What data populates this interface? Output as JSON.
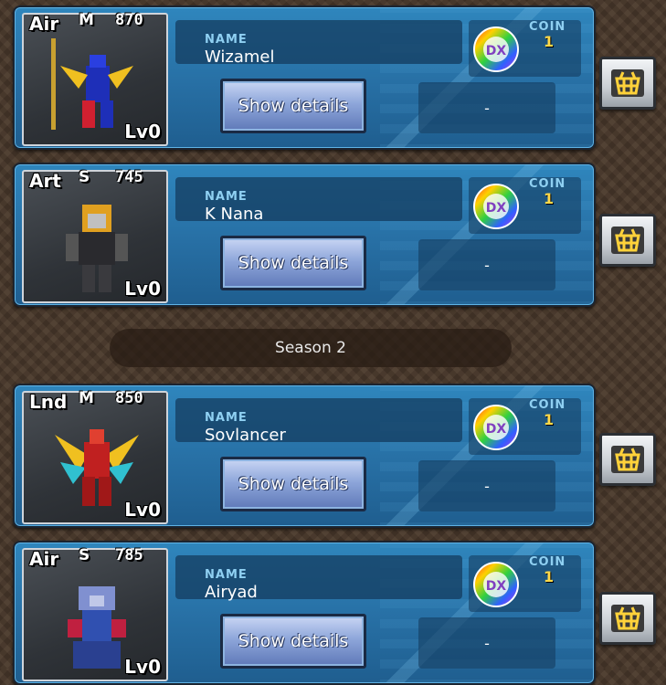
{
  "cards": [
    {
      "type": "Air",
      "size": "M",
      "cost": "870",
      "level": "Lv0",
      "name_label": "NAME",
      "name": "Wizamel",
      "button": "Show details",
      "coin_label": "COIN",
      "coin": "1",
      "status": "-",
      "colors": {
        "primary": "#1e2fb8",
        "accent": "#f0c020",
        "trim": "#d02030"
      }
    },
    {
      "type": "Art",
      "size": "S",
      "cost": "745",
      "level": "Lv0",
      "name_label": "NAME",
      "name": "K Nana",
      "button": "Show details",
      "coin_label": "COIN",
      "coin": "1",
      "status": "-",
      "colors": {
        "primary": "#2a2a2e",
        "accent": "#e0a020",
        "trim": "#909090"
      }
    },
    {
      "type": "Lnd",
      "size": "M",
      "cost": "850",
      "level": "Lv0",
      "name_label": "NAME",
      "name": "Sovlancer",
      "button": "Show details",
      "coin_label": "COIN",
      "coin": "1",
      "status": "-",
      "colors": {
        "primary": "#c02020",
        "accent": "#f0c020",
        "trim": "#30c0d0"
      }
    },
    {
      "type": "Air",
      "size": "S",
      "cost": "785",
      "level": "Lv0",
      "name_label": "NAME",
      "name": "Airyad",
      "button": "Show details",
      "coin_label": "COIN",
      "coin": "1",
      "status": "-",
      "colors": {
        "primary": "#3050b0",
        "accent": "#c02040",
        "trim": "#8090d0"
      }
    }
  ],
  "divider": {
    "label": "Season 2"
  },
  "icons": {
    "coin": "dx-coin-icon",
    "shop": "basket-icon"
  }
}
